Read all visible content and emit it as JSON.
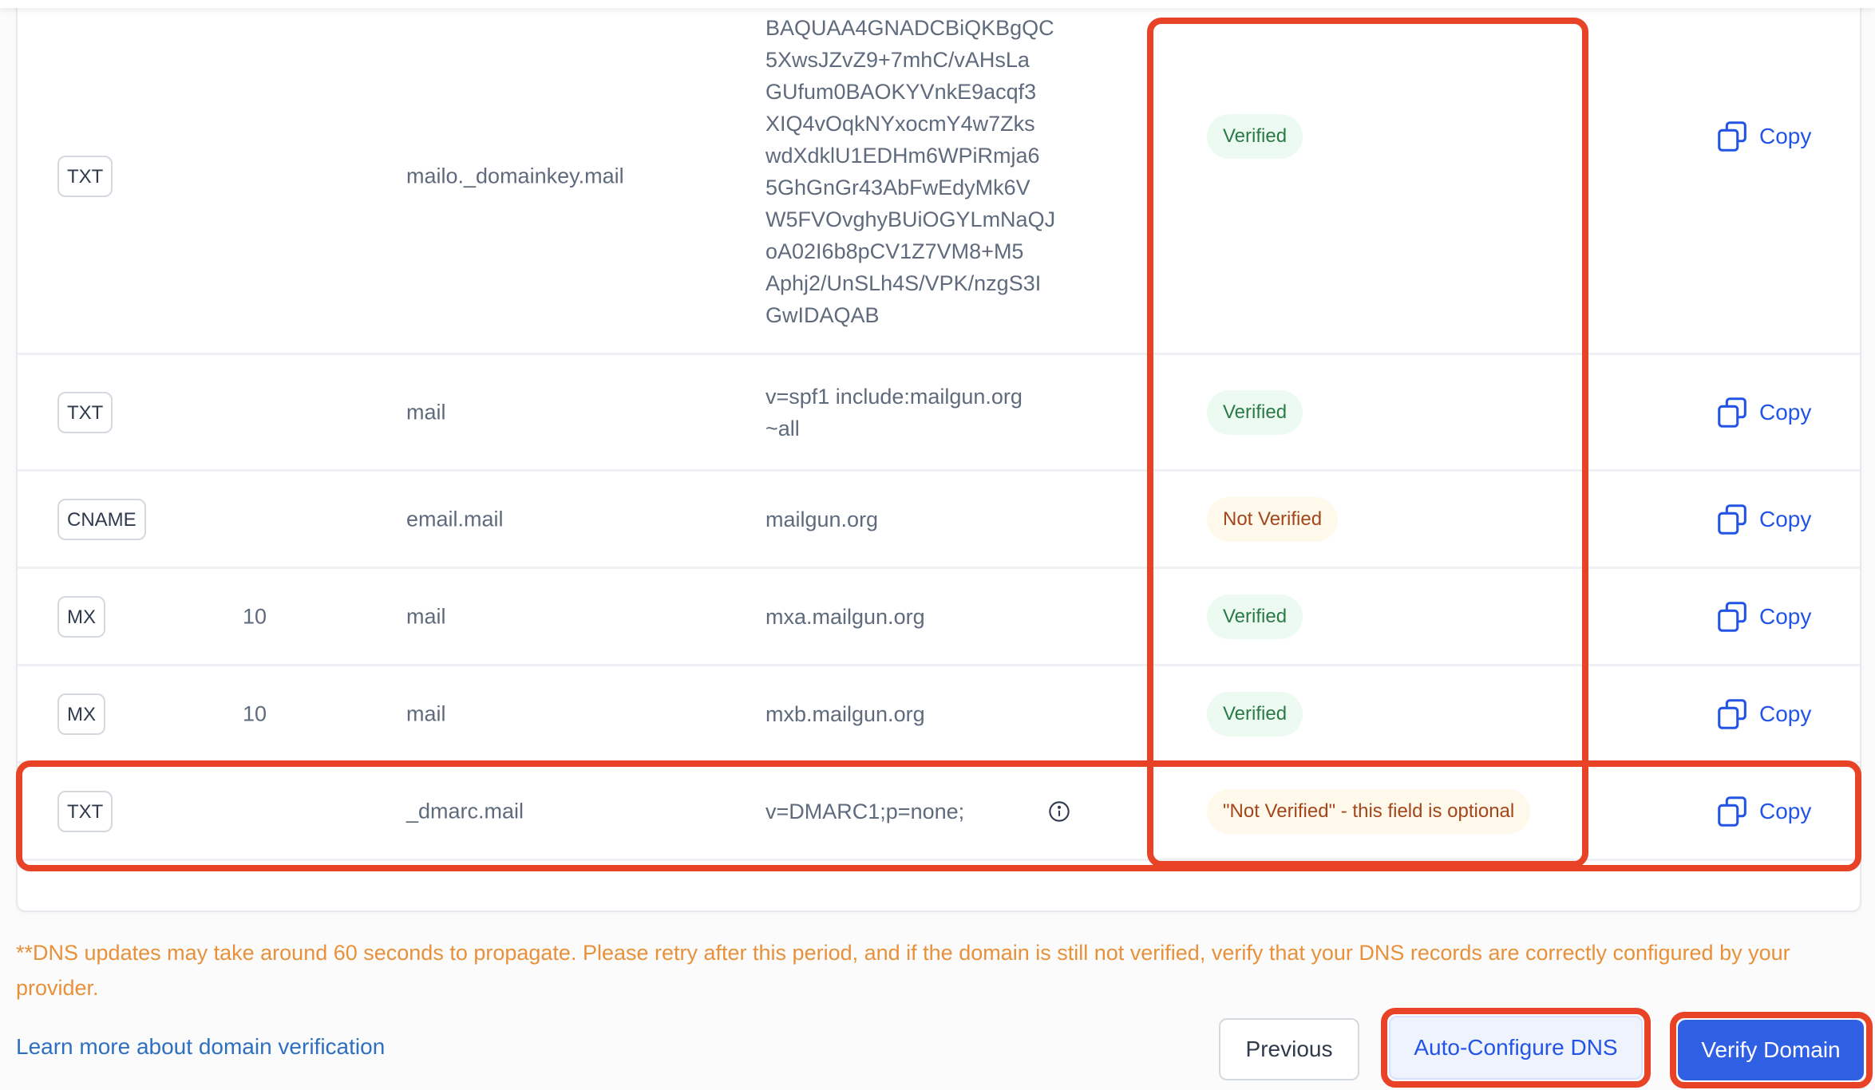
{
  "records": [
    {
      "type": "TXT",
      "priority": "",
      "host": "mailo._domainkey.mail",
      "value_lines": [
        "BAQUAA4GNADCBiQKBgQC",
        "5XwsJZvZ9+7mhC/vAHsLa",
        "GUfum0BAOKYVnkE9acqf3",
        "XIQ4vOqkNYxocmY4w7Zks",
        "wdXdklU1EDHm6WPiRmja6",
        "5GhGnGr43AbFwEdyMk6V",
        "W5FVOvghyBUiOGYLmNaQJ",
        "oA02I6b8pCV1Z7VM8+M5",
        "Aphj2/UnSLh4S/VPK/nzgS3I",
        "GwIDAQAB"
      ],
      "value": "",
      "has_info": false,
      "status": "Verified",
      "status_kind": "verified",
      "copy_label": "Copy"
    },
    {
      "type": "TXT",
      "priority": "",
      "host": "mail",
      "value_lines": [
        "v=spf1 include:mailgun.org",
        "~all"
      ],
      "value": "",
      "has_info": false,
      "status": "Verified",
      "status_kind": "verified",
      "copy_label": "Copy"
    },
    {
      "type": "CNAME",
      "priority": "",
      "host": "email.mail",
      "value": "mailgun.org",
      "has_info": false,
      "status": "Not Verified",
      "status_kind": "pending",
      "copy_label": "Copy"
    },
    {
      "type": "MX",
      "priority": "10",
      "host": "mail",
      "value": "mxa.mailgun.org",
      "has_info": false,
      "status": "Verified",
      "status_kind": "verified",
      "copy_label": "Copy"
    },
    {
      "type": "MX",
      "priority": "10",
      "host": "mail",
      "value": "mxb.mailgun.org",
      "has_info": false,
      "status": "Verified",
      "status_kind": "verified",
      "copy_label": "Copy"
    },
    {
      "type": "TXT",
      "priority": "",
      "host": "_dmarc.mail",
      "value": "v=DMARC1;p=none;",
      "has_info": true,
      "status": "\"Not Verified\" - this field is optional",
      "status_kind": "pending",
      "copy_label": "Copy"
    }
  ],
  "footer": {
    "note": "**DNS updates may take around 60 seconds to propagate. Please retry after this period, and if the domain is still not verified, verify that your DNS records are correctly configured by your provider.",
    "learn_more_link": "Learn more about domain verification",
    "previous_button": "Previous",
    "auto_configure_button": "Auto-Configure DNS",
    "verify_button": "Verify Domain"
  },
  "colors": {
    "accent": "#2f5fe3",
    "link": "#2f6fc0",
    "warning_text": "#e8913a",
    "verified_bg": "#ecfaf1",
    "verified_text": "#2b7a46",
    "pending_bg": "#fef9eb",
    "pending_text": "#a3461c",
    "annotation_highlight": "#e84327"
  },
  "icons": {
    "copy": "copy-icon",
    "info": "info-circle-icon"
  }
}
